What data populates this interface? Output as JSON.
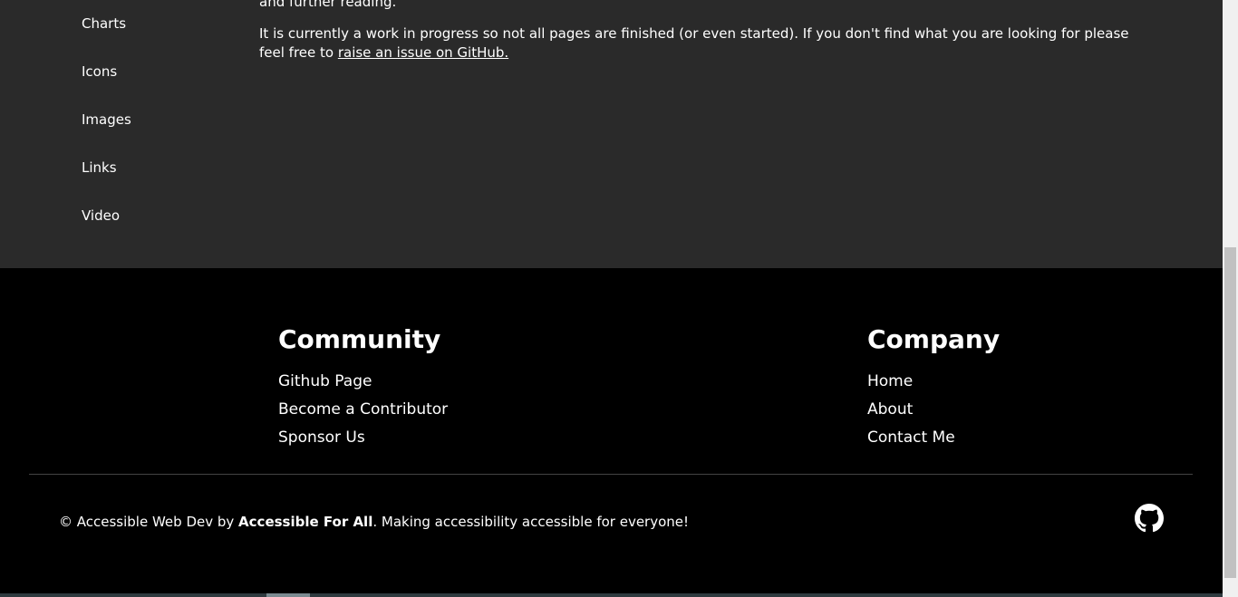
{
  "side_nav": {
    "items": [
      {
        "label": "Charts"
      },
      {
        "label": "Icons"
      },
      {
        "label": "Images"
      },
      {
        "label": "Links"
      },
      {
        "label": "Video"
      }
    ]
  },
  "main": {
    "partial_line": "and further reading.",
    "paragraph_text": "It is currently a work in progress so not all pages are finished (or even started). If you don't find what you are looking for please feel free to ",
    "issue_link": "raise an issue on GitHub."
  },
  "footer": {
    "community": {
      "heading": "Community",
      "links": [
        "Github Page",
        "Become a Contributor",
        "Sponsor Us"
      ]
    },
    "company": {
      "heading": "Company",
      "links": [
        "Home",
        "About",
        "Contact Me"
      ]
    },
    "copyright": {
      "prefix": "© Accessible Web Dev by ",
      "brand": "Accessible For All",
      "suffix": ". Making accessibility accessible for everyone!"
    },
    "github_icon": "github-icon"
  }
}
